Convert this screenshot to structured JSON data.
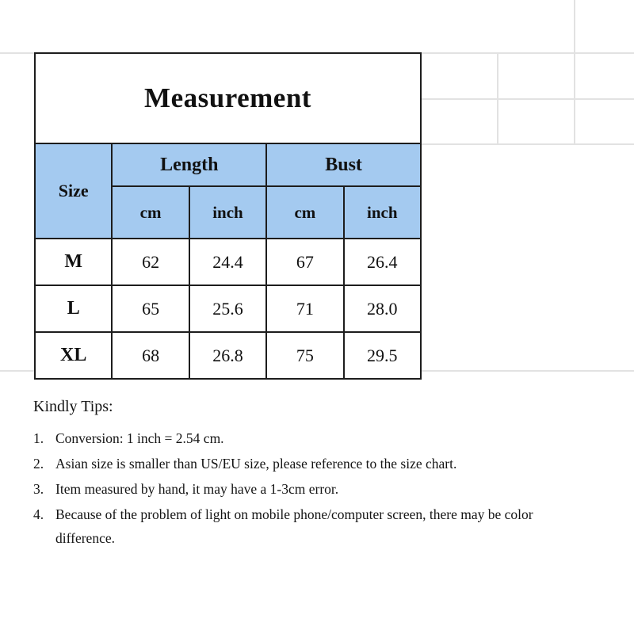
{
  "document": {
    "title": "Measurement",
    "accent_color": "#a4caf0",
    "border_color": "#1d1d1d",
    "gridline_color": "#e2e2e2"
  },
  "table": {
    "title": "Measurement",
    "size_header": "Size",
    "groups": [
      {
        "label": "Length",
        "units": [
          "cm",
          "inch"
        ]
      },
      {
        "label": "Bust",
        "units": [
          "cm",
          "inch"
        ]
      }
    ],
    "rows": [
      {
        "size": "M",
        "length_cm": "62",
        "length_inch": "24.4",
        "bust_cm": "67",
        "bust_inch": "26.4"
      },
      {
        "size": "L",
        "length_cm": "65",
        "length_inch": "25.6",
        "bust_cm": "71",
        "bust_inch": "28.0"
      },
      {
        "size": "XL",
        "length_cm": "68",
        "length_inch": "26.8",
        "bust_cm": "75",
        "bust_inch": "29.5"
      }
    ]
  },
  "tips": {
    "heading": "Kindly Tips:",
    "items": [
      {
        "num": "1.",
        "text": "Conversion: 1 inch = 2.54 cm."
      },
      {
        "num": "2.",
        "text": "Asian size is smaller than US/EU size, please reference to the size chart."
      },
      {
        "num": "3.",
        "text": "Item measured by hand, it may have a 1-3cm error."
      },
      {
        "num": "4.",
        "text": "Because of the problem of light on mobile phone/computer screen, there may be color difference."
      }
    ]
  },
  "chart_data": {
    "type": "table",
    "title": "Measurement",
    "columns": [
      "Size",
      "Length cm",
      "Length inch",
      "Bust cm",
      "Bust inch"
    ],
    "rows": [
      [
        "M",
        62,
        24.4,
        67,
        26.4
      ],
      [
        "L",
        65,
        25.6,
        71,
        28.0
      ],
      [
        "XL",
        68,
        26.8,
        75,
        29.5
      ]
    ]
  }
}
